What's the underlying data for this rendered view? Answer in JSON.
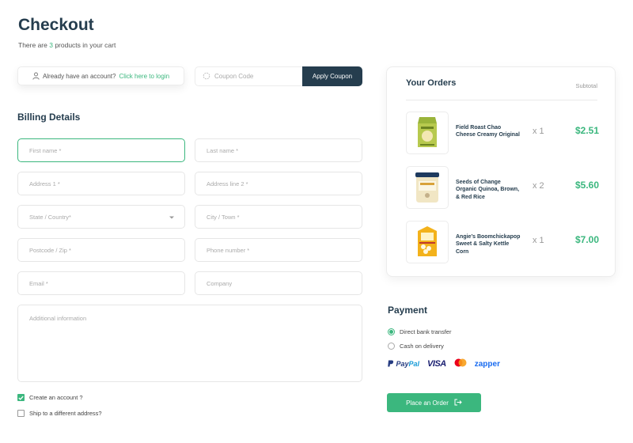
{
  "header": {
    "title": "Checkout",
    "subtitle_prefix": "There are ",
    "cart_count": "3",
    "subtitle_suffix": " products in your cart"
  },
  "login": {
    "text": "Already have an account?",
    "link": "Click here to login"
  },
  "coupon": {
    "placeholder": "Coupon Code",
    "button": "Apply Coupon"
  },
  "billing": {
    "title": "Billing Details",
    "fields": {
      "first_name": "First name *",
      "last_name": "Last name *",
      "address1": "Address 1 *",
      "address2": "Address line 2 *",
      "state": "State / Country*",
      "city": "City / Town *",
      "postcode": "Postcode / Zip *",
      "phone": "Phone number *",
      "email": "Email *",
      "company": "Company",
      "additional": "Additional information"
    },
    "create_account": "Create an account ?",
    "ship_different": "Ship to a different address?"
  },
  "orders": {
    "title": "Your Orders",
    "subtotal_label": "Subtotal",
    "items": [
      {
        "name": "Field Roast Chao Cheese Creamy Original",
        "qty": "x 1",
        "price": "$2.51"
      },
      {
        "name": "Seeds of Change Organic Quinoa, Brown, & Red Rice",
        "qty": "x 2",
        "price": "$5.60"
      },
      {
        "name": "Angie’s Boomchickapop Sweet & Salty Kettle Corn",
        "qty": "x 1",
        "price": "$7.00"
      }
    ]
  },
  "payment": {
    "title": "Payment",
    "options": [
      "Direct bank transfer",
      "Cash on delivery"
    ],
    "selected": "Direct bank transfer",
    "logos": {
      "paypal_a": "Pay",
      "paypal_b": "Pal",
      "visa": "VISA",
      "zapper": "zapper"
    },
    "place_order": "Place an Order"
  },
  "colors": {
    "accent": "#3BB77E",
    "dark": "#253D4E"
  }
}
